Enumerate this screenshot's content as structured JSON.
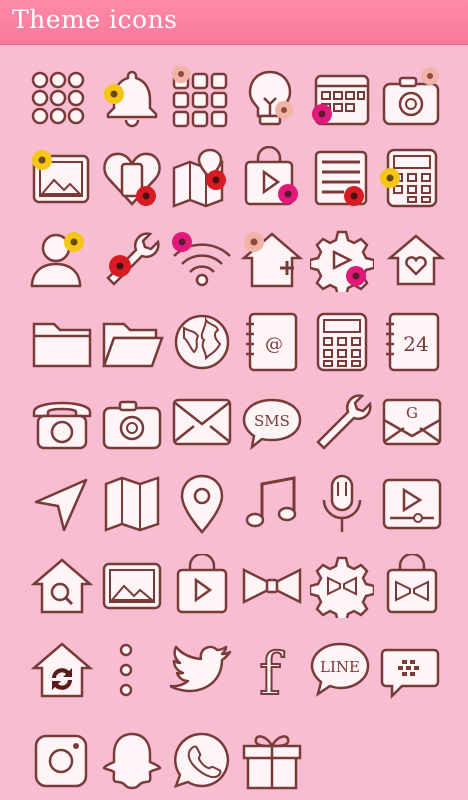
{
  "header": {
    "title": "Theme icons"
  },
  "icons": [
    {
      "name": "apps-drawer-icon",
      "flower": "none"
    },
    {
      "name": "bell-icon",
      "flower": "yellow"
    },
    {
      "name": "app-grid-icon",
      "flower": "peach"
    },
    {
      "name": "lightbulb-icon",
      "flower": "peach"
    },
    {
      "name": "calendar-icon",
      "flower": "magenta"
    },
    {
      "name": "camera-icon",
      "flower": "peach"
    },
    {
      "name": "gallery-icon",
      "flower": "yellow"
    },
    {
      "name": "phone-heart-icon",
      "flower": "red"
    },
    {
      "name": "map-pin-icon",
      "flower": "red"
    },
    {
      "name": "play-store-icon",
      "flower": "magenta"
    },
    {
      "name": "notes-icon",
      "flower": "red"
    },
    {
      "name": "calculator-icon",
      "flower": "yellow"
    },
    {
      "name": "contact-icon",
      "flower": "yellow"
    },
    {
      "name": "wrench-icon",
      "flower": "red"
    },
    {
      "name": "wifi-icon",
      "flower": "magenta"
    },
    {
      "name": "home-add-icon",
      "flower": "peach"
    },
    {
      "name": "settings-video-icon",
      "flower": "magenta"
    },
    {
      "name": "home-heart-icon",
      "flower": "none"
    },
    {
      "name": "folder-icon",
      "flower": "none"
    },
    {
      "name": "folder-open-icon",
      "flower": "none"
    },
    {
      "name": "globe-icon",
      "flower": "none"
    },
    {
      "name": "email-book-icon",
      "flower": "none"
    },
    {
      "name": "calculator-plain-icon",
      "flower": "none"
    },
    {
      "name": "calendar-24-icon",
      "flower": "none"
    },
    {
      "name": "telephone-icon",
      "flower": "none"
    },
    {
      "name": "camera-plain-icon",
      "flower": "none"
    },
    {
      "name": "mail-icon",
      "flower": "none"
    },
    {
      "name": "sms-icon",
      "flower": "none"
    },
    {
      "name": "wrench-plain-icon",
      "flower": "none"
    },
    {
      "name": "gmail-icon",
      "flower": "none"
    },
    {
      "name": "navigation-arrow-icon",
      "flower": "none"
    },
    {
      "name": "map-icon",
      "flower": "none"
    },
    {
      "name": "location-pin-icon",
      "flower": "none"
    },
    {
      "name": "music-note-icon",
      "flower": "none"
    },
    {
      "name": "microphone-icon",
      "flower": "none"
    },
    {
      "name": "video-player-icon",
      "flower": "none"
    },
    {
      "name": "home-search-icon",
      "flower": "none"
    },
    {
      "name": "picture-icon",
      "flower": "none"
    },
    {
      "name": "play-bag-icon",
      "flower": "none"
    },
    {
      "name": "ribbon-bow-icon",
      "flower": "none"
    },
    {
      "name": "gear-bow-icon",
      "flower": "none"
    },
    {
      "name": "bag-bow-icon",
      "flower": "none"
    },
    {
      "name": "home-sync-icon",
      "flower": "none"
    },
    {
      "name": "more-dots-icon",
      "flower": "none"
    },
    {
      "name": "bird-icon",
      "flower": "none"
    },
    {
      "name": "facebook-icon",
      "flower": "none"
    },
    {
      "name": "line-icon",
      "flower": "none"
    },
    {
      "name": "messenger-icon",
      "flower": "none"
    },
    {
      "name": "instagram-icon",
      "flower": "none"
    },
    {
      "name": "ghost-icon",
      "flower": "none"
    },
    {
      "name": "whatsapp-icon",
      "flower": "none"
    },
    {
      "name": "gift-icon",
      "flower": "none"
    }
  ],
  "labels": {
    "email_at": "@",
    "calendar_day": "24",
    "sms": "SMS",
    "gmail": "G",
    "line": "LINE",
    "facebook": "f"
  },
  "colors": {
    "header": "#f7799b",
    "background": "#f7bdd1",
    "icon_fill": "#fff4f6",
    "icon_stroke": "#7a3a3a",
    "flower_yellow": "#f5c518",
    "flower_red": "#d81b22",
    "flower_magenta": "#e2197b",
    "flower_peach": "#f1b3a8"
  }
}
